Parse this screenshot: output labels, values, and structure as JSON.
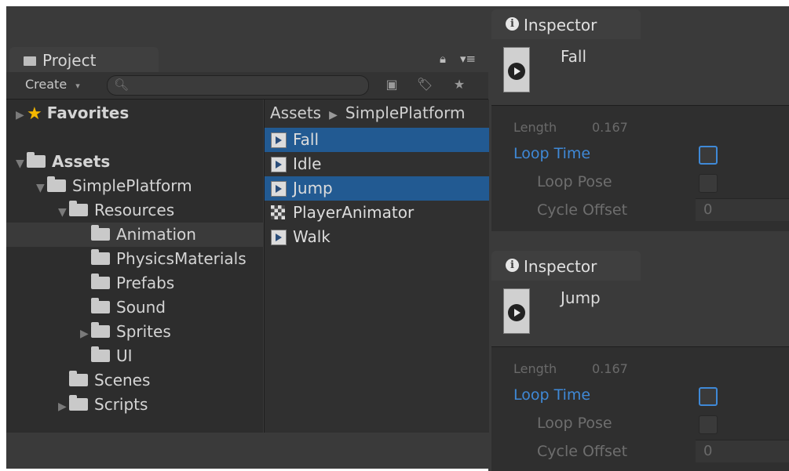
{
  "project": {
    "tab_label": "Project",
    "create_label": "Create",
    "search_placeholder": "",
    "tree": {
      "favorites": "Favorites",
      "assets": "Assets",
      "simple_platform": "SimplePlatform",
      "resources": "Resources",
      "animation": "Animation",
      "physics_materials": "PhysicsMaterials",
      "prefabs": "Prefabs",
      "sound": "Sound",
      "sprites": "Sprites",
      "ui": "UI",
      "scenes": "Scenes",
      "scripts": "Scripts"
    },
    "breadcrumb": {
      "root": "Assets",
      "current": "SimplePlatform"
    },
    "files": [
      "Fall",
      "Idle",
      "Jump",
      "PlayerAnimator",
      "Walk"
    ]
  },
  "inspectors": [
    {
      "tab_label": "Inspector",
      "clip_name": "Fall",
      "length_label": "Length",
      "length_value": "0.167",
      "loop_time_label": "Loop Time",
      "loop_pose_label": "Loop Pose",
      "cycle_offset_label": "Cycle Offset",
      "cycle_offset_value": "0"
    },
    {
      "tab_label": "Inspector",
      "clip_name": "Jump",
      "length_label": "Length",
      "length_value": "0.167",
      "loop_time_label": "Loop Time",
      "loop_pose_label": "Loop Pose",
      "cycle_offset_label": "Cycle Offset",
      "cycle_offset_value": "0"
    }
  ],
  "colors": {
    "selection": "#225a92",
    "accent_blue": "#3f89d7",
    "panel_dark": "#282828",
    "star": "#f5b800"
  }
}
